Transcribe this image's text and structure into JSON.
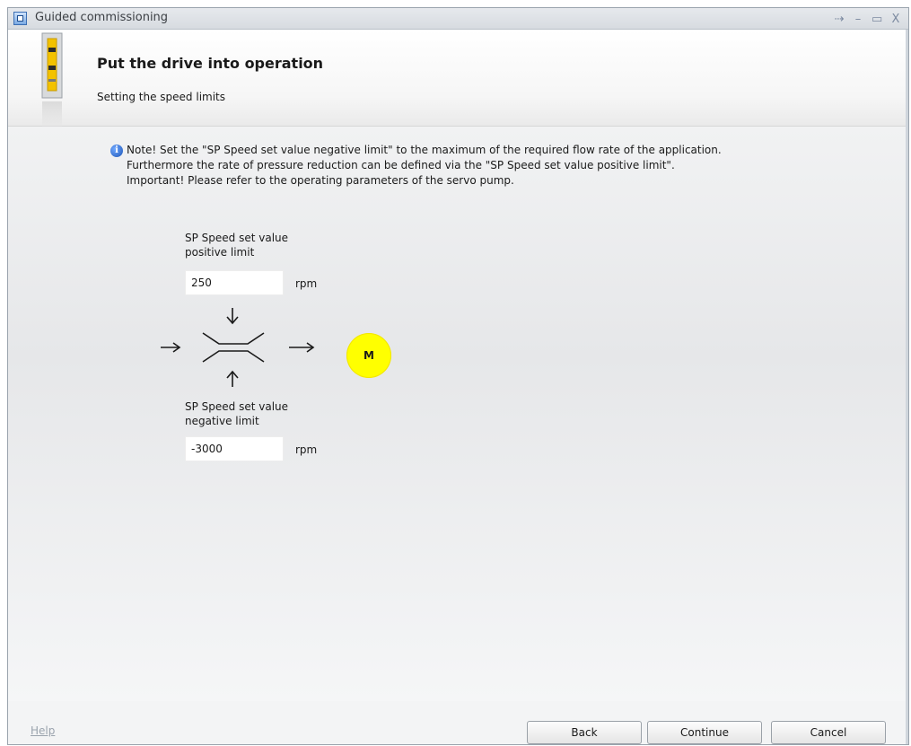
{
  "window": {
    "title": "Guided commissioning",
    "controls": [
      "pin-icon",
      "minimize-icon",
      "maximize-icon",
      "close-icon"
    ]
  },
  "header": {
    "title": "Put the drive into operation",
    "subtitle": "Setting the speed limits"
  },
  "note": {
    "lines": [
      "Note! Set the \"SP Speed set value negative limit\" to the maximum of the required flow rate of the application.",
      "Furthermore the rate of pressure reduction can be defined via the \"SP Speed set value positive limit\".",
      "Important! Please refer to the operating parameters of the servo pump."
    ]
  },
  "positive_limit": {
    "label_line1": "SP Speed set value",
    "label_line2": "positive limit",
    "value": "250",
    "unit": "rpm"
  },
  "negative_limit": {
    "label_line1": "SP Speed set value",
    "label_line2": "negative limit",
    "value": "-3000",
    "unit": "rpm"
  },
  "diagram": {
    "motor_label": "M"
  },
  "footer": {
    "help_label": "Help",
    "back_label": "Back",
    "continue_label": "Continue",
    "cancel_label": "Cancel"
  },
  "colors": {
    "motor": "#ffff00",
    "device_accent": "#f3c200",
    "info_icon": "#2a66c9"
  }
}
